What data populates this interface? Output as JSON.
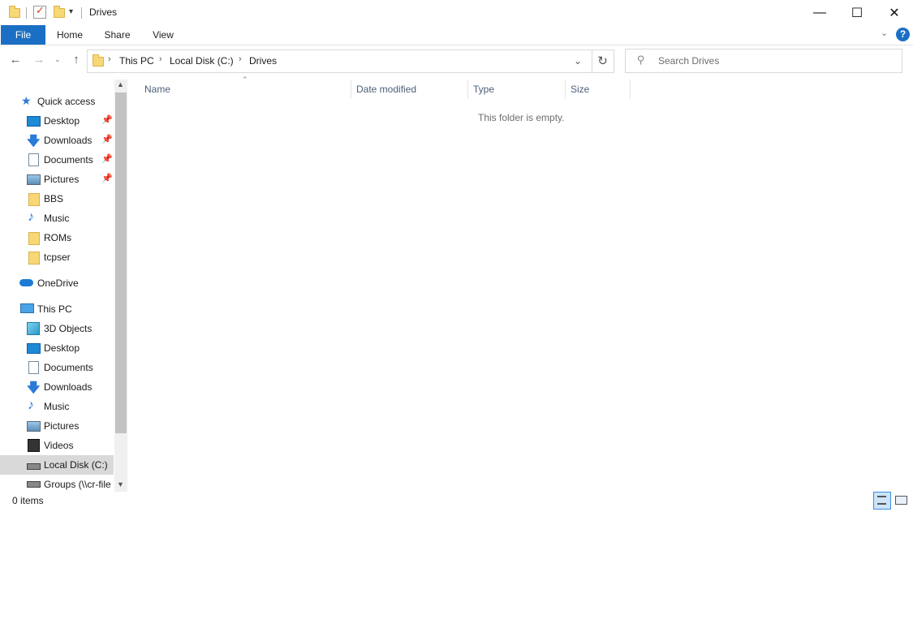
{
  "window": {
    "title": "Drives",
    "controls": {
      "minimize": "—",
      "maximize": "☐",
      "close": "✕"
    }
  },
  "ribbon": {
    "tabs": [
      {
        "label": "File"
      },
      {
        "label": "Home"
      },
      {
        "label": "Share"
      },
      {
        "label": "View"
      }
    ]
  },
  "address": {
    "crumbs": [
      "This PC",
      "Local Disk (C:)",
      "Drives"
    ]
  },
  "search": {
    "placeholder": "Search Drives"
  },
  "sidebar": {
    "quick_access": {
      "label": "Quick access"
    },
    "quick_items": [
      {
        "label": "Desktop",
        "icon": "desktop-icon",
        "pinned": true
      },
      {
        "label": "Downloads",
        "icon": "download-icon",
        "pinned": true
      },
      {
        "label": "Documents",
        "icon": "document-icon",
        "pinned": true
      },
      {
        "label": "Pictures",
        "icon": "pictures-icon",
        "pinned": true
      },
      {
        "label": "BBS",
        "icon": "folder-icon",
        "pinned": false
      },
      {
        "label": "Music",
        "icon": "music-icon",
        "pinned": false
      },
      {
        "label": "ROMs",
        "icon": "folder-icon",
        "pinned": false
      },
      {
        "label": "tcpser",
        "icon": "folder-icon",
        "pinned": false
      }
    ],
    "onedrive": {
      "label": "OneDrive"
    },
    "this_pc": {
      "label": "This PC"
    },
    "pc_items": [
      {
        "label": "3D Objects",
        "icon": "cube-icon"
      },
      {
        "label": "Desktop",
        "icon": "desktop-icon"
      },
      {
        "label": "Documents",
        "icon": "document-icon"
      },
      {
        "label": "Downloads",
        "icon": "download-icon"
      },
      {
        "label": "Music",
        "icon": "music-icon"
      },
      {
        "label": "Pictures",
        "icon": "pictures-icon"
      },
      {
        "label": "Videos",
        "icon": "video-icon"
      },
      {
        "label": "Local Disk (C:)",
        "icon": "drive-icon"
      },
      {
        "label": "Groups (\\\\cr-file",
        "icon": "network-drive-icon"
      }
    ]
  },
  "columns": [
    {
      "label": "Name"
    },
    {
      "label": "Date modified"
    },
    {
      "label": "Type"
    },
    {
      "label": "Size"
    }
  ],
  "content": {
    "empty_message": "This folder is empty."
  },
  "status": {
    "item_count": "0 items"
  }
}
